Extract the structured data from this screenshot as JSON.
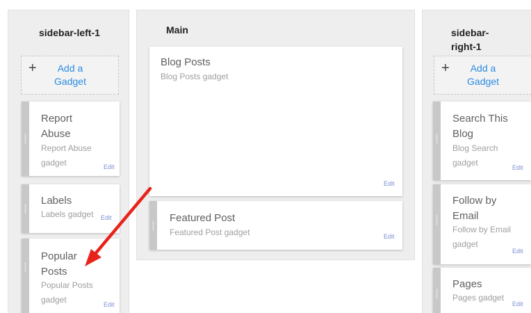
{
  "columns": {
    "left": {
      "title": "sidebar-left-1"
    },
    "main": {
      "title": "Main"
    },
    "right": {
      "title": "sidebar-right-1"
    }
  },
  "add_gadget": {
    "label": "Add a Gadget",
    "icon": "plus-icon"
  },
  "edit_label": "Edit",
  "gadgets": {
    "report_abuse": {
      "title": "Report Abuse",
      "description": "Report Abuse gadget"
    },
    "labels": {
      "title": "Labels",
      "description": "Labels gadget"
    },
    "popular_posts": {
      "title": "Popular Posts",
      "description": "Popular Posts gadget"
    },
    "blog_posts": {
      "title": "Blog Posts",
      "description": "Blog Posts gadget"
    },
    "featured_post": {
      "title": "Featured Post",
      "description": "Featured Post gadget"
    },
    "search_blog": {
      "title": "Search This Blog",
      "description": "Blog Search gadget"
    },
    "follow_email": {
      "title": "Follow by Email",
      "description": "Follow by Email gadget"
    },
    "pages": {
      "title": "Pages",
      "description": "Pages gadget"
    }
  },
  "annotation": {
    "type": "red-arrow",
    "color": "#e8231b",
    "points_to": "Popular Posts"
  },
  "colors": {
    "column_bg": "#eeeeee",
    "accent_link": "#2b8ae3",
    "edit_link": "#7b8fd4",
    "handle": "#c8c8c8"
  }
}
